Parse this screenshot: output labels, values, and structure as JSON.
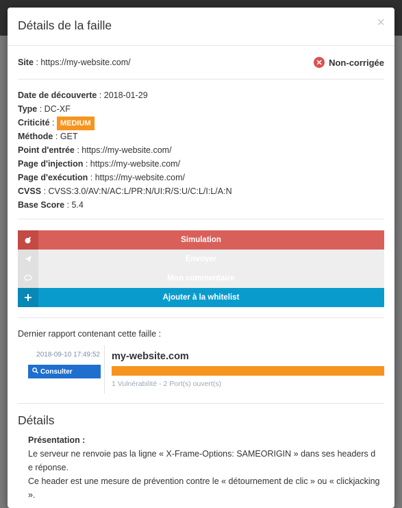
{
  "modal": {
    "title": "Détails de la faille",
    "close": "×"
  },
  "site": {
    "label": "Site",
    "sep": " : ",
    "value": "https://my-website.com/"
  },
  "status": {
    "label": "Non-corrigée",
    "color": "#d9534f"
  },
  "info": {
    "discovery_label": "Date de découverte",
    "discovery": "2018-01-29",
    "type_label": "Type",
    "type": "DC-XF",
    "criticity_label": "Criticité",
    "criticity": "MEDIUM",
    "method_label": "Méthode",
    "method": "GET",
    "entry_label": "Point d'entrée",
    "entry": "https://my-website.com/",
    "injection_label": "Page d'injection",
    "injection": "https://my-website.com/",
    "execution_label": "Page d'exécution",
    "execution": "https://my-website.com/",
    "cvss_label": "CVSS",
    "cvss": "CVSS:3.0/AV:N/AC:L/PR:N/UI:R/S:U/C:L/I:L/A:N",
    "score_label": "Base Score",
    "score": "5.4",
    "sep": " : "
  },
  "actions": {
    "simulation": "Simulation",
    "send": "Envoyer",
    "comment": "Mon commentaire",
    "whitelist": "Ajouter à la whitelist"
  },
  "report": {
    "title": "Dernier rapport contenant cette faille :",
    "date": "2018-09-10 17:49:52",
    "consult": "Consulter",
    "site": "my-website.com",
    "stats": "1 Vulnérabilité - 2 Port(s) ouvert(s)"
  },
  "details": {
    "title": "Détails",
    "subtitle": "Présentation :",
    "p1": "Le serveur ne renvoie pas la ligne « X-Frame-Options: SAMEORIGIN » dans ses headers de réponse.",
    "p2": "Ce header est une mesure de prévention contre le « détournement de clic » ou « clickjacking »."
  }
}
